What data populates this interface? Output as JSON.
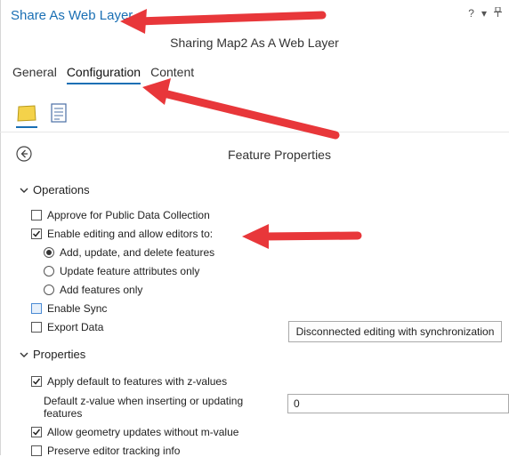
{
  "header": {
    "title": "Share As Web Layer",
    "help": "?",
    "menu": "▾",
    "pin": "📌"
  },
  "subtitle": "Sharing Map2 As A Web Layer",
  "tabs": [
    {
      "label": "General"
    },
    {
      "label": "Configuration"
    },
    {
      "label": "Content"
    }
  ],
  "panel": {
    "title": "Feature Properties"
  },
  "operations": {
    "label": "Operations",
    "approve": "Approve for Public Data Collection",
    "enable_editing": "Enable editing and allow editors to:",
    "radio_options": [
      "Add, update, and delete features",
      "Update feature attributes only",
      "Add features only"
    ],
    "enable_sync": "Enable Sync",
    "export_data": "Export Data",
    "sync_button": "Disconnected editing with synchronization"
  },
  "properties": {
    "label": "Properties",
    "z_default": "Apply default to features with z-values",
    "z_label": "Default z-value when inserting or updating features",
    "z_value": "0",
    "geometry_updates": "Allow geometry updates without m-value",
    "preserve_tracking": "Preserve editor tracking info"
  },
  "colors": {
    "accent": "#1a6fb4",
    "annotation_arrow": "#e8373a"
  }
}
